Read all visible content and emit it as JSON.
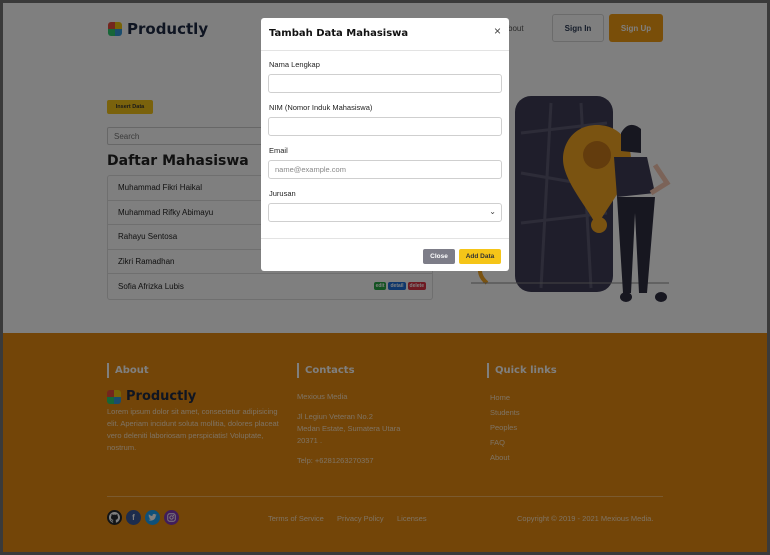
{
  "header": {
    "brand": "Productly",
    "nav_about": "bout",
    "signin_label": "Sign In",
    "signup_label": "Sign Up"
  },
  "main": {
    "insert_label": "Insert Data",
    "search_placeholder": "Search",
    "list_title": "Daftar Mahasiswa",
    "students": [
      "Muhammad Fikri Haikal",
      "Muhammad Rifky Abimayu",
      "Rahayu Sentosa",
      "Zikri Ramadhan",
      "Sofia Afrizka Lubis"
    ],
    "actions": {
      "edit": "edit",
      "detail": "detail",
      "delete": "delete"
    }
  },
  "modal": {
    "title": "Tambah Data Mahasiswa",
    "close_symbol": "×",
    "fields": {
      "nama_label": "Nama Lengkap",
      "nim_label": "NIM (Nomor Induk Mahasiswa)",
      "email_label": "Email",
      "email_placeholder": "name@example.com",
      "jurusan_label": "Jurusan"
    },
    "close_label": "Close",
    "add_label": "Add Data"
  },
  "footer": {
    "about_heading": "About",
    "about_brand": "Productly",
    "about_text": "Lorem ipsum dolor sit amet, consectetur adipisicing elit. Aperiam incidunt soluta mollitia, dolores placeat vero deleniti laboriosam perspiciatis! Voluptate, nostrum.",
    "contacts_heading": "Contacts",
    "company": "Mexious Media",
    "address1": "Jl Legiun Veteran No.2",
    "address2": "Medan Estate, Sumatera Utara",
    "address3": "20371 .",
    "phone": "Telp: +6281263270357",
    "quick_heading": "Quick links",
    "quick_links": [
      "Home",
      "Students",
      "Peoples",
      "FAQ",
      "About"
    ],
    "bottom_links": [
      "Terms of Service",
      "Privacy Policy",
      "Licenses"
    ],
    "copyright": "Copyright © 2019 - 2021 Mexious Media."
  },
  "colors": {
    "accent_orange": "#f39c12",
    "footer_orange": "#e68a10",
    "insert_yellow": "#f5c518"
  },
  "icons": [
    "productly-logo-icon",
    "close-icon",
    "chevron-down-icon",
    "github-icon",
    "facebook-icon",
    "twitter-icon",
    "instagram-icon"
  ]
}
